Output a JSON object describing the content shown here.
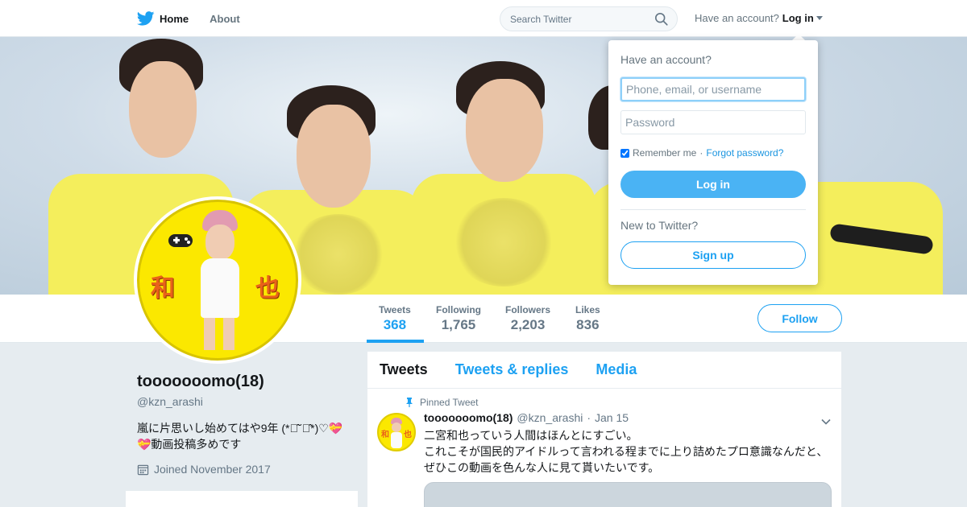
{
  "nav": {
    "home_label": "Home",
    "about_label": "About",
    "search_placeholder": "Search Twitter",
    "have_account": "Have an account?",
    "login_label": "Log in",
    "brand_color": "#1da1f2"
  },
  "profile": {
    "name": "tooooooomo(18)",
    "handle": "@kzn_arashi",
    "bio": "嵐に片思いし始めてはや9年 (*ฅ̂˘ฅ̂*)♡💝💝動画投稿多めです",
    "joined": "Joined November 2017",
    "avatar_text_left": "和",
    "avatar_text_right": "也"
  },
  "stats": [
    {
      "label": "Tweets",
      "value": "368"
    },
    {
      "label": "Following",
      "value": "1,765"
    },
    {
      "label": "Followers",
      "value": "2,203"
    },
    {
      "label": "Likes",
      "value": "836"
    }
  ],
  "follow_label": "Follow",
  "tabs": [
    {
      "label": "Tweets"
    },
    {
      "label": "Tweets & replies"
    },
    {
      "label": "Media"
    }
  ],
  "tweet": {
    "pinned_label": "Pinned Tweet",
    "name": "tooooooomo(18)",
    "handle": "@kzn_arashi",
    "separator": "·",
    "date": "Jan 15",
    "lines": [
      "二宮和也っていう人間はほんとにすごい。",
      "これこそが国民的アイドルって言われる程までに上り詰めたプロ意識なんだと、",
      "ぜひこの動画を色んな人に見て貰いたいです。"
    ]
  },
  "login_dropdown": {
    "title": "Have an account?",
    "username_placeholder": "Phone, email, or username",
    "password_placeholder": "Password",
    "remember_label": "Remember me",
    "separator": "·",
    "forgot_label": "Forgot password?",
    "login_button": "Log in",
    "new_label": "New to Twitter?",
    "signup_button": "Sign up"
  },
  "icons": [
    "twitter-bird-icon",
    "search-icon",
    "caret-down-icon",
    "calendar-icon",
    "pin-icon",
    "chevron-down-icon"
  ]
}
